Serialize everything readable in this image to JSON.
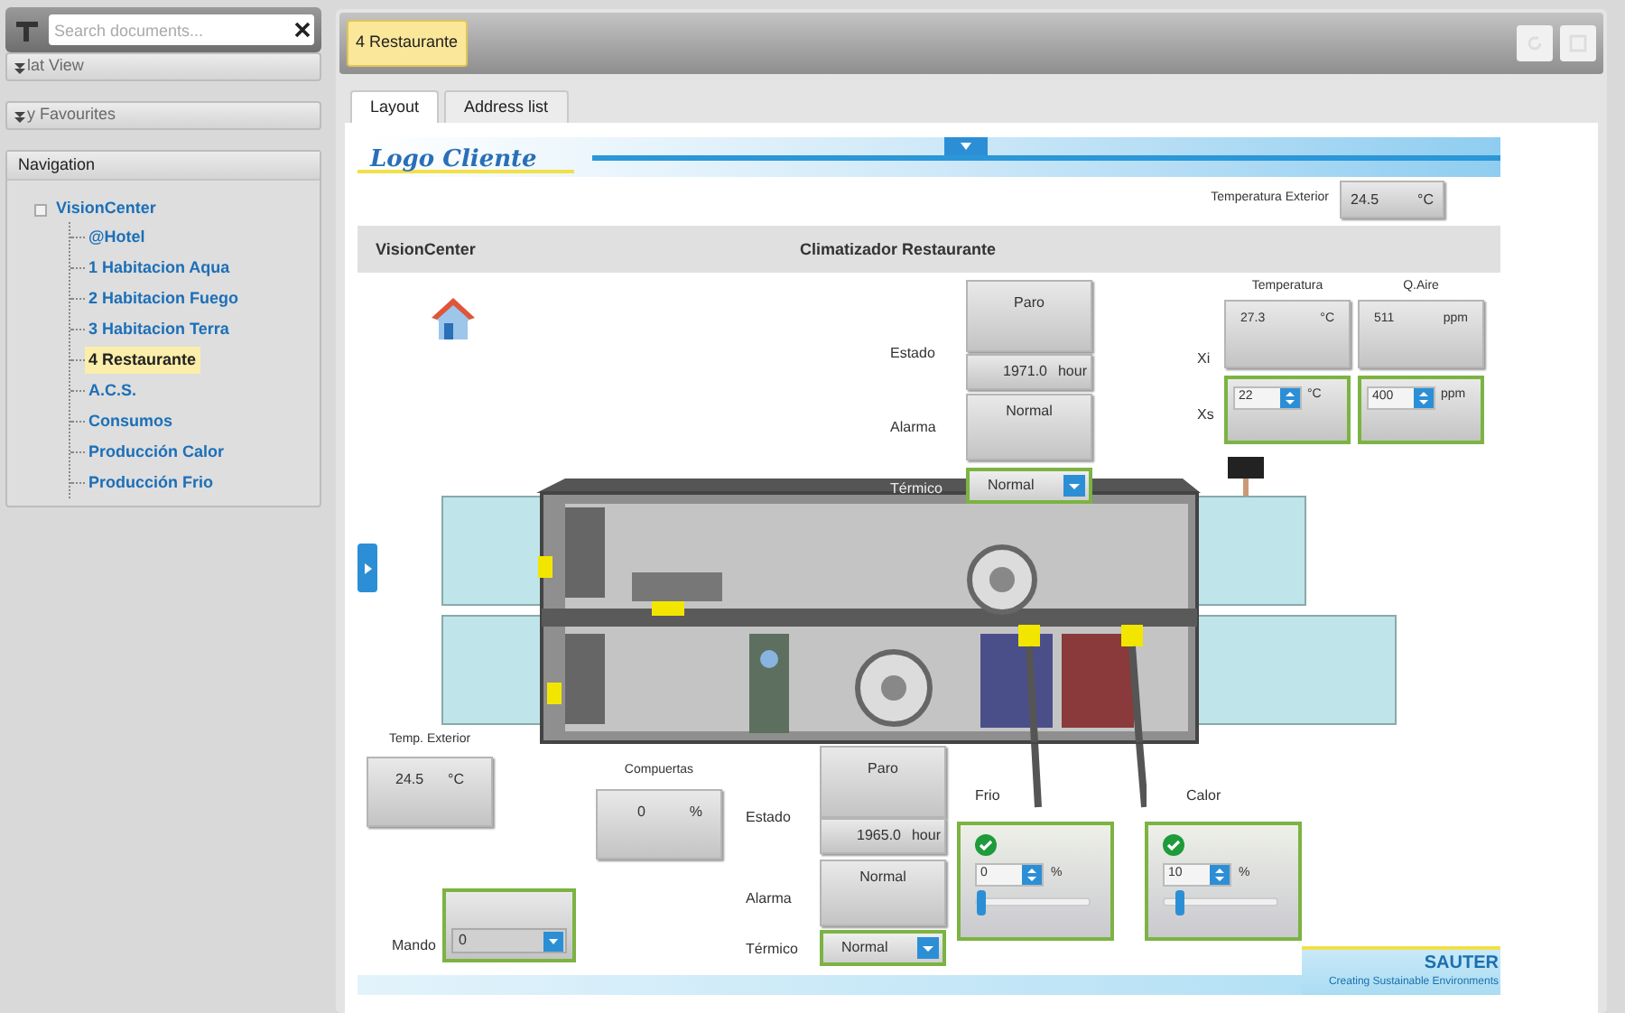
{
  "sidebar": {
    "search": {
      "placeholder": "Search documents..."
    },
    "sections": [
      {
        "label": "lat View",
        "expanded": false
      },
      {
        "label": "y Favourites",
        "expanded": false
      }
    ],
    "navigation": {
      "title": "Navigation",
      "tree": {
        "label": "VisionCenter",
        "expanded": true,
        "selected": false,
        "children": [
          {
            "label": "@Hotel",
            "selected": false
          },
          {
            "label": "1 Habitacion Aqua",
            "selected": false
          },
          {
            "label": "2 Habitacion Fuego",
            "selected": false
          },
          {
            "label": "3 Habitacion Terra",
            "selected": false
          },
          {
            "label": "4 Restaurante",
            "selected": true
          },
          {
            "label": "A.C.S.",
            "selected": false
          },
          {
            "label": "Consumos",
            "selected": false
          },
          {
            "label": "Producción Calor",
            "selected": false
          },
          {
            "label": "Producción Frio",
            "selected": false
          }
        ]
      }
    }
  },
  "document": {
    "title": "4 Restaurante",
    "tabs": [
      {
        "label": "Layout",
        "selected": true
      },
      {
        "label": "Address list",
        "selected": false
      }
    ],
    "mimic": {
      "logo": "Logo Cliente",
      "outdoor_temp": {
        "label": "Temperatura Exterior",
        "value": "24.5",
        "unit": "°C"
      },
      "header": [
        "VisionCenter",
        "Climatizador Restaurante"
      ],
      "fans": [
        {
          "estado_label": "Estado",
          "estado": "Paro",
          "hours": "1971.0",
          "hours_unit": "hour",
          "alarma_label": "Alarma",
          "alarma": "Normal",
          "termico_label": "Térmico",
          "termico": "Normal"
        },
        {
          "estado_label": "Estado",
          "estado": "Paro",
          "hours": "1965.0",
          "hours_unit": "hour",
          "alarma_label": "Alarma",
          "alarma": "Normal",
          "termico_label": "Térmico",
          "termico": "Normal"
        }
      ],
      "xi_label": "Xi",
      "xs_label": "Xs",
      "columns": [
        {
          "label": "Temperatura",
          "actual": "27.3",
          "actual_unit": "°C",
          "setpoint": "22",
          "setpoint_unit": "°C"
        },
        {
          "label": "Q.Aire",
          "actual": "511",
          "actual_unit": "ppm",
          "setpoint": "400",
          "setpoint_unit": "ppm"
        }
      ],
      "temp_exterior": {
        "label": "Temp. Exterior",
        "value": "24.5",
        "unit": "°C"
      },
      "compuertas": {
        "label": "Compuertas",
        "value": "0",
        "unit": "%"
      },
      "mando": {
        "label": "Mando",
        "value": "0"
      },
      "valves": [
        {
          "label": "Frio",
          "ok": true,
          "value": "0",
          "unit": "%",
          "level": 0
        },
        {
          "label": "Calor",
          "ok": true,
          "value": "10",
          "unit": "%",
          "level": 0.1
        }
      ],
      "brand": {
        "name": "SAUTER",
        "tagline": "Creating Sustainable Environments"
      }
    }
  }
}
